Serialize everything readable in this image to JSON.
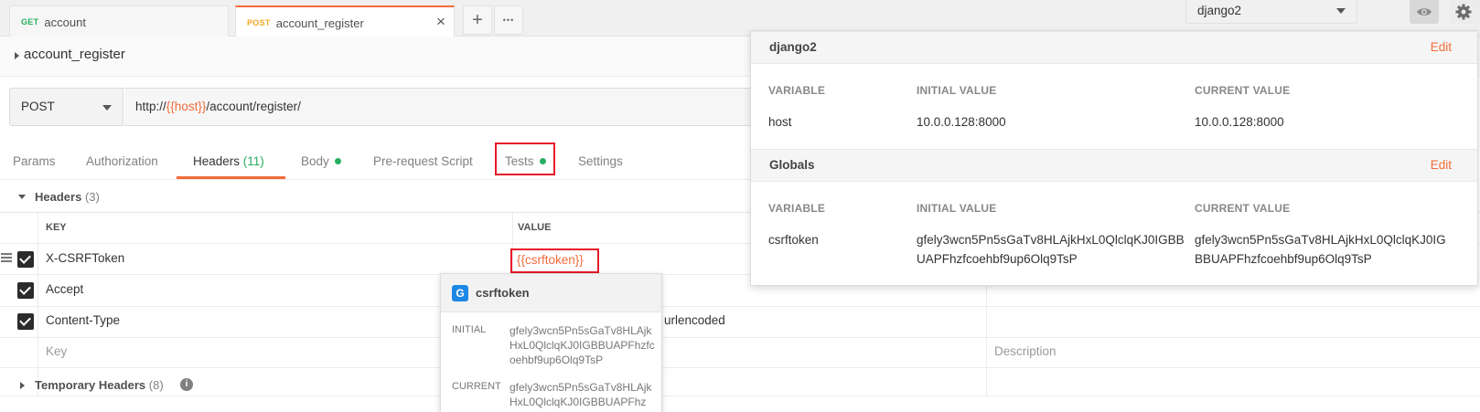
{
  "tabs": [
    {
      "method": "GET",
      "method_color": "#27ae60",
      "name": "account",
      "active": false
    },
    {
      "method": "POST",
      "method_color": "#f5a623",
      "name": "account_register",
      "active": true
    }
  ],
  "tab_close": "×",
  "tab_add": "+",
  "tab_more": "•••",
  "environment": {
    "selected": "django2"
  },
  "request": {
    "name": "account_register",
    "method": "POST",
    "url_prefix": "http://",
    "url_var": "{{host}}",
    "url_suffix": "/account/register/"
  },
  "subtabs": {
    "params": "Params",
    "authorization": "Authorization",
    "headers": "Headers",
    "headers_count": "(11)",
    "body": "Body",
    "prerequest": "Pre-request Script",
    "tests": "Tests",
    "settings": "Settings"
  },
  "headers_section": {
    "title": "Headers",
    "count": "(3)",
    "col_key": "KEY",
    "col_value": "VALUE",
    "rows": [
      {
        "key": "X-CSRFToken",
        "value": "{{csrftoken}}"
      },
      {
        "key": "Accept",
        "value": ""
      },
      {
        "key": "Content-Type",
        "value": "urlencoded"
      }
    ],
    "placeholder_key": "Key",
    "placeholder_description": "Description"
  },
  "temporary_headers": {
    "title": "Temporary Headers",
    "count": "(8)",
    "info": "i"
  },
  "var_tooltip": {
    "badge": "G",
    "name": "csrftoken",
    "initial_label": "INITIAL",
    "initial_value": "gfely3wcn5Pn5sGaTv8HLAjkHxL0QlclqKJ0IGBBUAPFhzfcoehbf9up6Olq9TsP",
    "current_label": "CURRENT",
    "current_value": "gfely3wcn5Pn5sGaTv8HLAjkHxL0QlclqKJ0IGBBUAPFhz"
  },
  "env_panel": {
    "environment": {
      "title": "django2",
      "edit": "Edit",
      "col_variable": "VARIABLE",
      "col_initial": "INITIAL VALUE",
      "col_current": "CURRENT VALUE",
      "variable": "host",
      "initial": "10.0.0.128:8000",
      "current": "10.0.0.128:8000"
    },
    "globals": {
      "title": "Globals",
      "edit": "Edit",
      "col_variable": "VARIABLE",
      "col_initial": "INITIAL VALUE",
      "col_current": "CURRENT VALUE",
      "variable": "csrftoken",
      "initial_line1": "gfely3wcn5Pn5sGaTv8HLAjkHxL0QlclqKJ0IGBB",
      "initial_line2": "UAPFhzfcoehbf9up6Olq9TsP",
      "current_line1": "gfely3wcn5Pn5sGaTv8HLAjkHxL0QlclqKJ0IG",
      "current_line2": "BBUAPFhzfcoehbf9up6Olq9TsP"
    }
  },
  "colors": {
    "accent": "#f26b3a",
    "green": "#27ae60",
    "highlight_box": "#e8182a",
    "global_badge": "#1e88e5"
  }
}
